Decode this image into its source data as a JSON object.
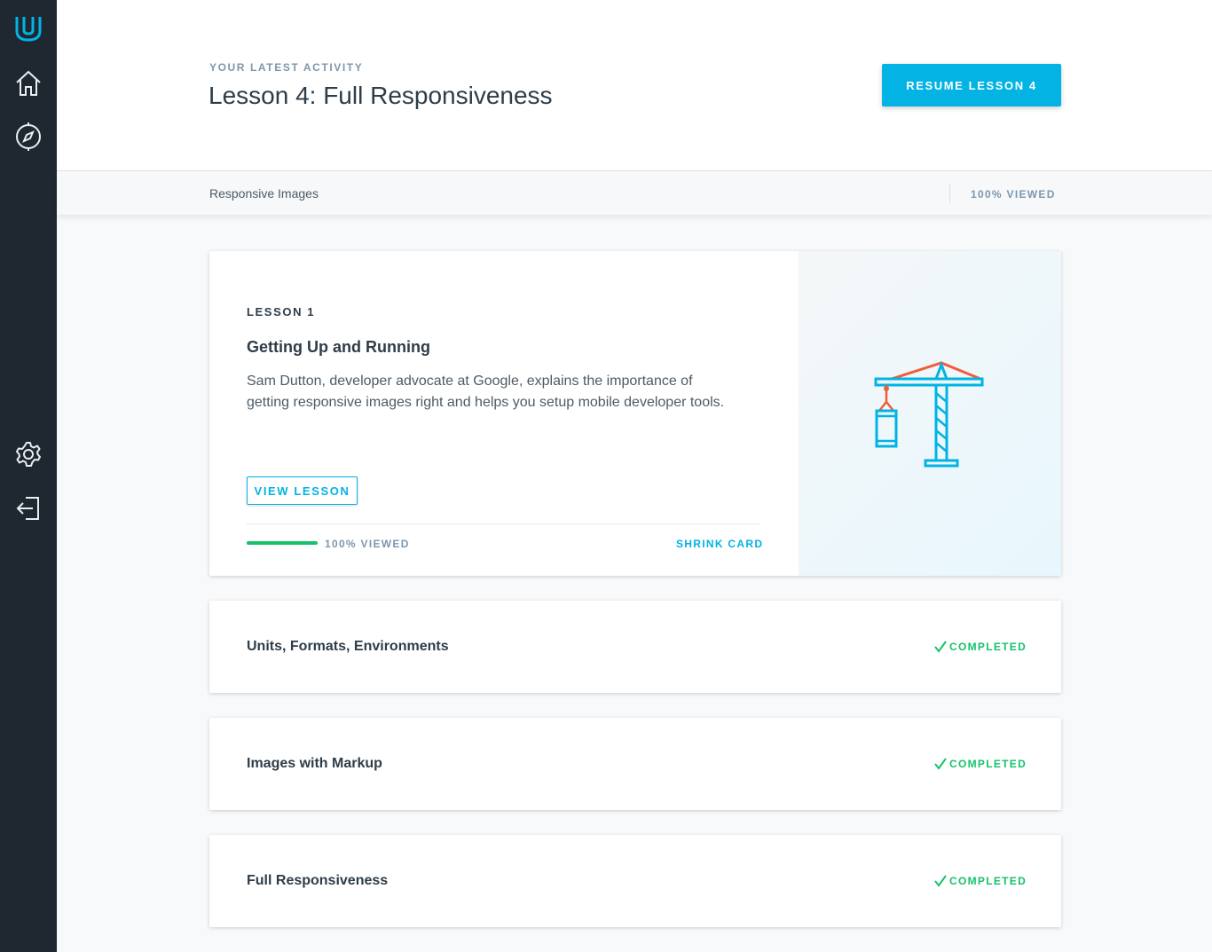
{
  "sidebar": {
    "icons": [
      "udacity-logo-icon",
      "home-icon",
      "compass-icon",
      "gear-icon",
      "logout-icon"
    ]
  },
  "header": {
    "eyebrow": "YOUR LATEST ACTIVITY",
    "title": "Lesson 4: Full Responsiveness",
    "resume_label": "RESUME LESSON 4"
  },
  "subbar": {
    "label": "Responsive Images",
    "status": "100% VIEWED"
  },
  "main_card": {
    "label": "LESSON 1",
    "title": "Getting Up and Running",
    "description": "Sam Dutton, developer advocate at Google, explains the importance of getting responsive images right and helps you setup mobile developer tools.",
    "view_label": "VIEW LESSON",
    "progress_text": "100% VIEWED",
    "progress_fraction": 1.0,
    "shrink_label": "SHRINK CARD",
    "illustration": "crane-icon"
  },
  "lessons": [
    {
      "title": "Units, Formats, Environments",
      "status": "COMPLETED"
    },
    {
      "title": "Images with Markup",
      "status": "COMPLETED"
    },
    {
      "title": "Full Responsiveness",
      "status": "COMPLETED"
    }
  ],
  "colors": {
    "accent": "#02b3e4",
    "success": "#15c26b",
    "sidebar": "#1f2831",
    "crane_accent": "#f15c3b"
  }
}
